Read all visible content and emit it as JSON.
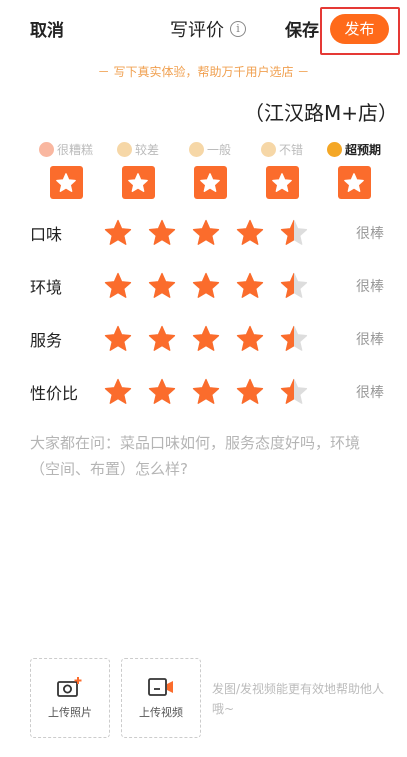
{
  "header": {
    "cancel": "取消",
    "title": "写评价",
    "info": "i",
    "save": "保存",
    "publish": "发布"
  },
  "slogan": "－ 写下真实体验，帮助万千用户选店 －",
  "shop_name": "（江汉路M+店）",
  "levels": [
    {
      "label": "很糟糕",
      "icon": "sad-face-icon"
    },
    {
      "label": "较差",
      "icon": "unhappy-face-icon"
    },
    {
      "label": "一般",
      "icon": "neutral-face-icon"
    },
    {
      "label": "不错",
      "icon": "smile-face-icon"
    },
    {
      "label": "超预期",
      "icon": "surprised-face-icon"
    }
  ],
  "rows": [
    {
      "label": "口味",
      "rating": 4.5,
      "value": "很棒"
    },
    {
      "label": "环境",
      "rating": 4.5,
      "value": "很棒"
    },
    {
      "label": "服务",
      "rating": 4.5,
      "value": "很棒"
    },
    {
      "label": "性价比",
      "rating": 4.5,
      "value": "很棒"
    }
  ],
  "prompt": "大家都在问：菜品口味如何，服务态度好吗，环境（空间、布置）怎么样?",
  "upload_photo": "上传照片",
  "upload_video": "上传视频",
  "tip": "发图/发视频能更有效地帮助他人哦~",
  "colors": {
    "accent": "#fb6c2c",
    "empty_star": "#dddddd"
  }
}
